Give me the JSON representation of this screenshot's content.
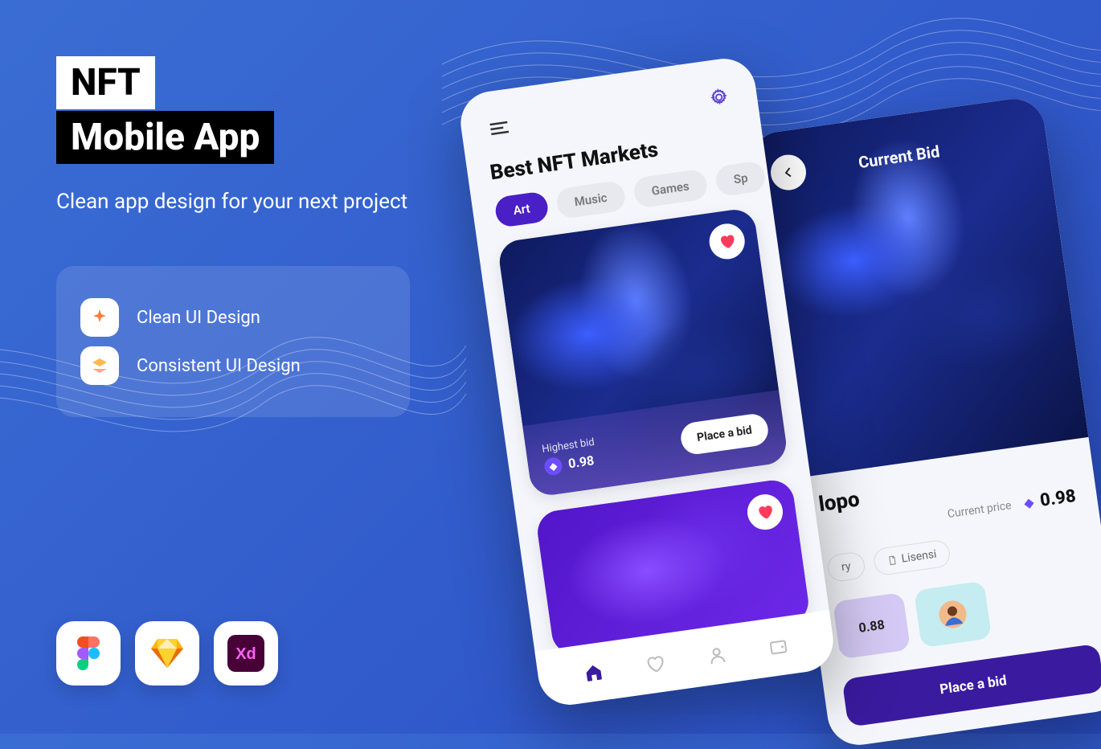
{
  "hero": {
    "title1": "NFT",
    "title2": "Mobile App",
    "subtitle": "Clean app design for your next project"
  },
  "features": [
    {
      "label": "Clean UI Design"
    },
    {
      "label": "Consistent UI Design"
    }
  ],
  "tools": [
    "Figma",
    "Sketch",
    "Adobe XD"
  ],
  "phone1": {
    "title": "Best NFT Markets",
    "chips": [
      "Art",
      "Music",
      "Games",
      "Sp"
    ],
    "active_chip": "Art",
    "card1": {
      "highest_bid_label": "Highest bid",
      "highest_bid_value": "0.98",
      "place_bid": "Place a bid"
    },
    "nav": [
      "home",
      "heart",
      "user",
      "wallet"
    ]
  },
  "phone2": {
    "hero_title": "Current Bid",
    "name": "lopo",
    "price_label": "Current price",
    "price_value": "0.98",
    "tags": [
      "ry",
      "Lisensi"
    ],
    "tile_value": "0.88",
    "place_bid": "Place a bid"
  }
}
